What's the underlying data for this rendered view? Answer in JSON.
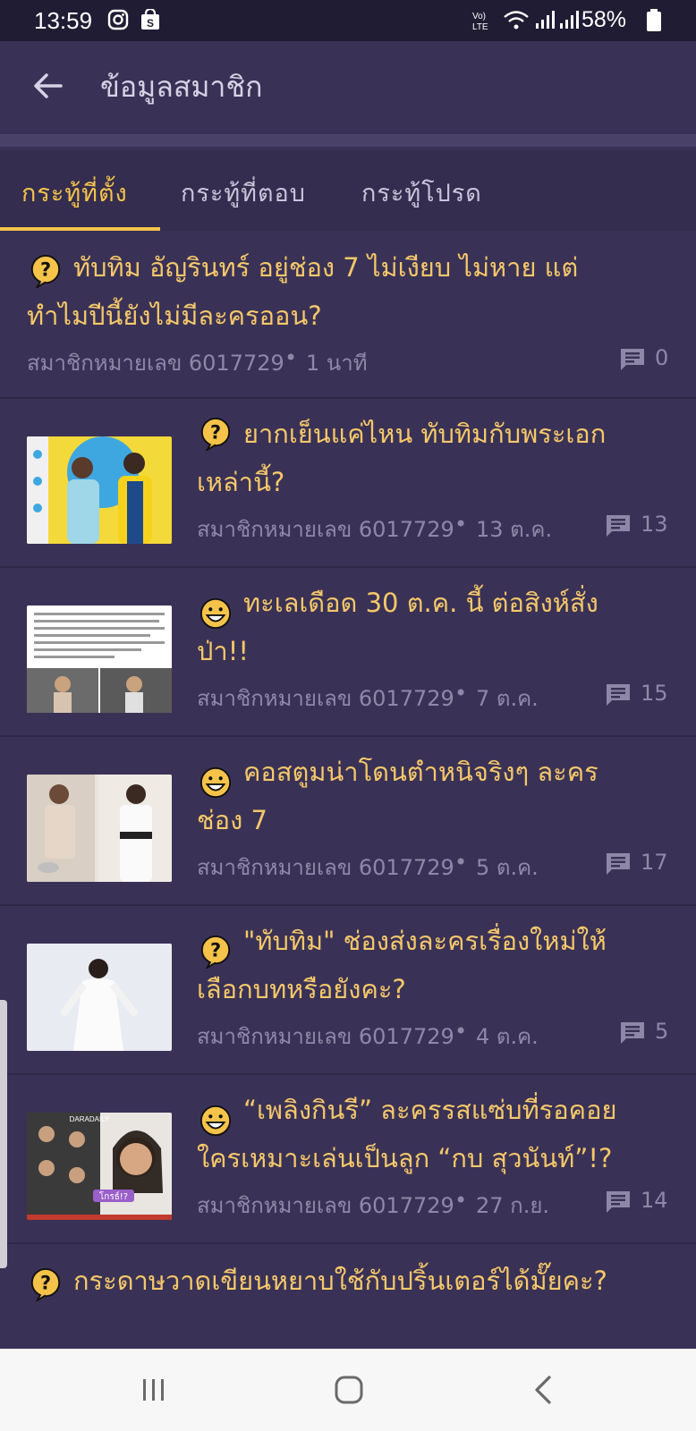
{
  "status_bar": {
    "time": "13:59",
    "battery": "58%",
    "network": "VoLTE"
  },
  "header": {
    "title": "ข้อมูลสมาชิก"
  },
  "tabs": [
    {
      "label": "กระทู้ที่ตั้ง",
      "active": true
    },
    {
      "label": "กระทู้ที่ตอบ",
      "active": false
    },
    {
      "label": "กระทู้โปรด",
      "active": false
    }
  ],
  "posts": [
    {
      "icon": "question-emoji-icon",
      "title_line1": "ทับทิม อัญรินทร์ อยู่ช่อง 7 ไม่เงียบ ไม่หาย แต่",
      "title_line2": "ทำไมปีนี้ยังไม่มีละครออน?",
      "author": "สมาชิกหมายเลข 6017729",
      "time": "1 นาที",
      "comments": "0"
    },
    {
      "icon": "question-emoji-icon",
      "title_line1": "ยากเย็นแค่ไหน ทับทิมกับพระเอก",
      "title_line2": "เหล่านี้?",
      "author": "สมาชิกหมายเลข 6017729",
      "time": "13 ต.ค.",
      "comments": "13"
    },
    {
      "icon": "smile-emoji-icon",
      "title_line1": "ทะเลเดือด 30 ต.ค. นี้ ต่อสิงห์สั่ง",
      "title_line2": "ป่า!!",
      "author": "สมาชิกหมายเลข 6017729",
      "time": "7 ต.ค.",
      "comments": "15"
    },
    {
      "icon": "smile-emoji-icon",
      "title_line1": "คอสตูมน่าโดนตำหนิจริงๆ ละคร",
      "title_line2": "ช่อง 7",
      "author": "สมาชิกหมายเลข 6017729",
      "time": "5 ต.ค.",
      "comments": "17"
    },
    {
      "icon": "question-emoji-icon",
      "title_line1": "\"ทับทิม\" ช่องส่งละครเรื่องใหม่ให้",
      "title_line2": "เลือกบทหรือยังคะ?",
      "author": "สมาชิกหมายเลข 6017729",
      "time": "4 ต.ค.",
      "comments": "5"
    },
    {
      "icon": "smile-emoji-icon",
      "title_line1": "“เพลิงกินรี” ละครรสแซ่บที่รอคอย",
      "title_line2": "ใครเหมาะเล่นเป็นลูก “กบ สุวนันท์”!?",
      "author": "สมาชิกหมายเลข 6017729",
      "time": "27 ก.ย.",
      "comments": "14"
    },
    {
      "icon": "question-emoji-icon",
      "title_line1": "กระดาษวาดเขียนหยาบใช้กับปริ้นเตอร์ได้มั๊ยคะ?"
    }
  ],
  "thumbnails": {
    "post2_caption": "โกรธ์!?",
    "post2_brand": "DARADAILY"
  },
  "colors": {
    "background": "#3a3256",
    "accent": "#f5c34a",
    "title_text": "#f5c86a",
    "meta_text": "#8e88a8",
    "status_bar": "#201c34",
    "nav_bar": "#f7f7f7"
  }
}
